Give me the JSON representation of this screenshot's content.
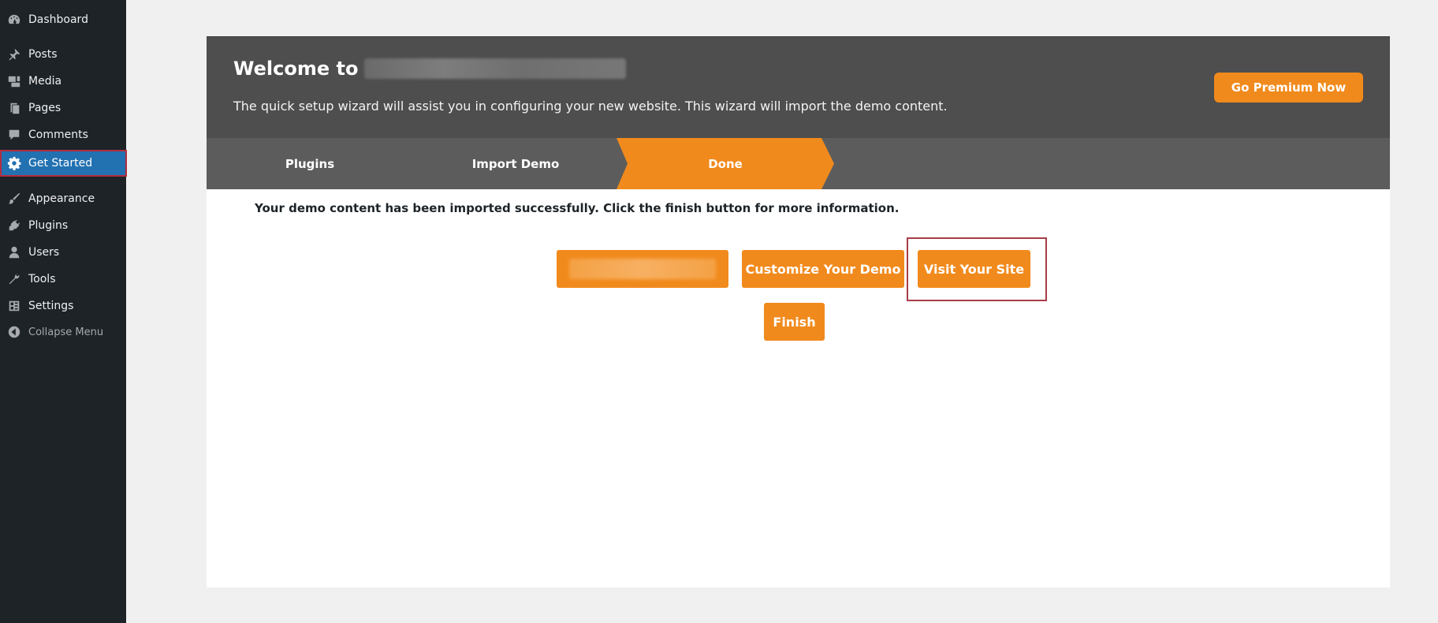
{
  "sidebar": {
    "items": [
      {
        "label": "Dashboard",
        "icon": "dashboard-icon"
      },
      {
        "label": "Posts",
        "icon": "pin-icon"
      },
      {
        "label": "Media",
        "icon": "media-icon"
      },
      {
        "label": "Pages",
        "icon": "pages-icon"
      },
      {
        "label": "Comments",
        "icon": "comment-icon"
      },
      {
        "label": "Get Started",
        "icon": "gear-icon",
        "active": true
      },
      {
        "label": "Appearance",
        "icon": "brush-icon"
      },
      {
        "label": "Plugins",
        "icon": "plugin-icon"
      },
      {
        "label": "Users",
        "icon": "user-icon"
      },
      {
        "label": "Tools",
        "icon": "wrench-icon"
      },
      {
        "label": "Settings",
        "icon": "settings-icon"
      },
      {
        "label": "Collapse Menu",
        "icon": "collapse-icon"
      }
    ]
  },
  "hero": {
    "title_prefix": "Welcome to",
    "description": "The quick setup wizard will assist you in configuring your new website. This wizard will import the demo content.",
    "premium_label": "Go Premium Now"
  },
  "steps": [
    {
      "label": "Plugins"
    },
    {
      "label": "Import Demo"
    },
    {
      "label": "Done",
      "active": true
    }
  ],
  "content": {
    "success_message": "Your demo content has been imported successfully. Click the finish button for more information.",
    "customize_label": "Customize Your Demo",
    "visit_label": "Visit Your Site",
    "finish_label": "Finish"
  },
  "colors": {
    "accent": "#f18a1c",
    "sidebar_bg": "#1d2327",
    "active_menu": "#2271b1",
    "highlight_border": "#a83d48",
    "hero_bg": "#4e4e4e",
    "steps_bg": "#5c5c5c"
  }
}
